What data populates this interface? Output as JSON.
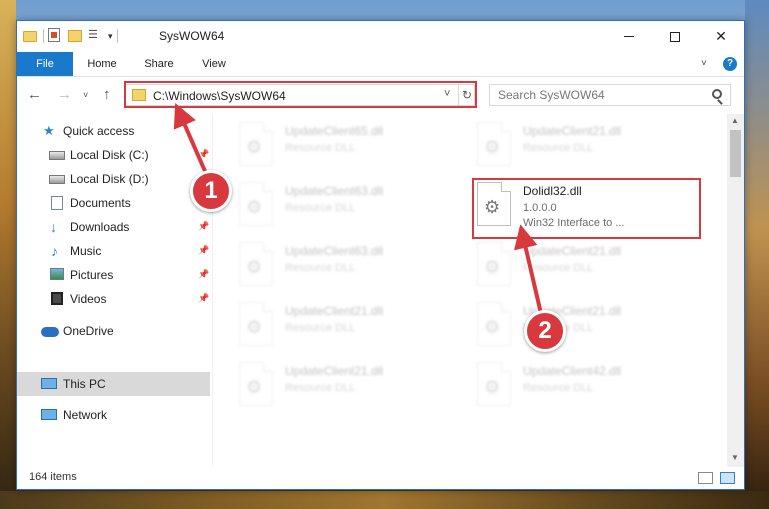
{
  "window": {
    "title": "SysWOW64",
    "controls": {
      "minimize": "minimize",
      "maximize": "maximize",
      "close": "✕"
    }
  },
  "ribbon": {
    "tabs": [
      "File",
      "Home",
      "Share",
      "View"
    ],
    "help": "?"
  },
  "navbar": {
    "address": "C:\\Windows\\SysWOW64",
    "search_placeholder": "Search SysWOW64"
  },
  "sidebar": {
    "items": [
      {
        "label": "Quick access",
        "icon": "star-icon"
      },
      {
        "label": "Local Disk (C:)",
        "icon": "disk-icon"
      },
      {
        "label": "Local Disk (D:)",
        "icon": "disk-icon"
      },
      {
        "label": "Documents",
        "icon": "documents-icon"
      },
      {
        "label": "Downloads",
        "icon": "download-icon"
      },
      {
        "label": "Music",
        "icon": "music-icon"
      },
      {
        "label": "Pictures",
        "icon": "pictures-icon"
      },
      {
        "label": "Videos",
        "icon": "videos-icon"
      },
      {
        "label": "OneDrive",
        "icon": "cloud-icon"
      },
      {
        "label": "This PC",
        "icon": "computer-icon",
        "selected": true
      },
      {
        "label": "Network",
        "icon": "network-icon"
      }
    ]
  },
  "files": [
    {
      "name": "UpdateClient65.dll",
      "desc": "Resource DLL"
    },
    {
      "name": "UpdateClient21.dll",
      "desc": "Resource DLL"
    },
    {
      "name": "UpdateClient63.dll",
      "desc": "Resource DLL"
    },
    {
      "name": "Dolidl32.dll",
      "desc": "1.0.0.0",
      "desc2": "Win32 Interface to ..."
    },
    {
      "name": "UpdateClient63.dll",
      "desc": "Resource DLL"
    },
    {
      "name": "UpdateClient21.dll",
      "desc": "Resource DLL"
    },
    {
      "name": "UpdateClient21.dll",
      "desc": "Resource DLL"
    },
    {
      "name": "UpdateClient21.dll",
      "desc": "Resource DLL"
    },
    {
      "name": "UpdateClient21.dll",
      "desc": "Resource DLL"
    },
    {
      "name": "UpdateClient42.dll",
      "desc": "Resource DLL"
    }
  ],
  "status": {
    "item_count": "164 items"
  },
  "callouts": {
    "step1": "1",
    "step2": "2"
  },
  "colors": {
    "accent": "#1979ca",
    "highlight": "#d7393f"
  }
}
